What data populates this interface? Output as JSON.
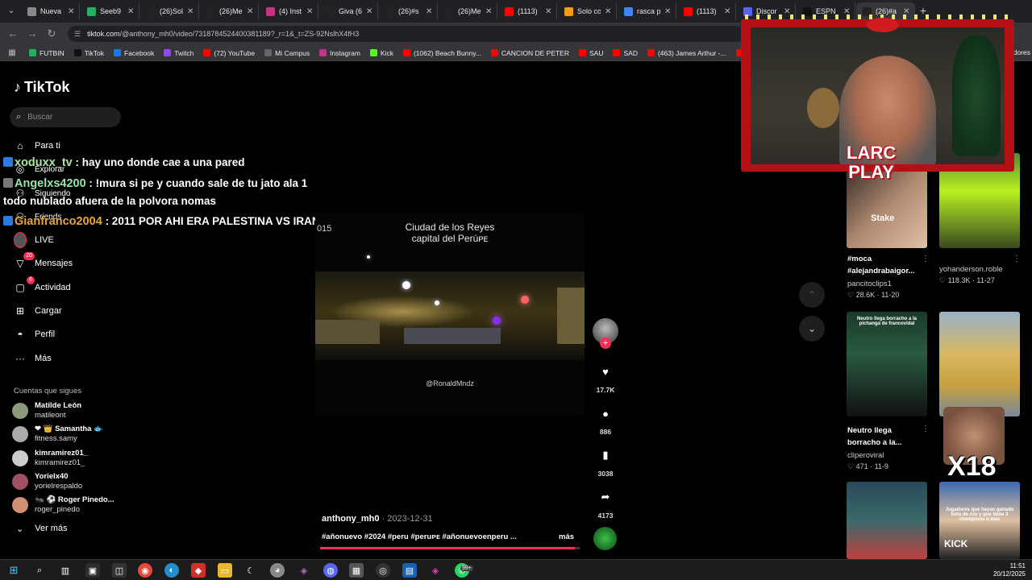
{
  "browser": {
    "tabs": [
      {
        "label": "Nueva",
        "color": "#888888"
      },
      {
        "label": "Seeb9",
        "color": "#27ae60"
      },
      {
        "label": "(26)Sol",
        "color": "#222222"
      },
      {
        "label": "(26)Me",
        "color": "#222222"
      },
      {
        "label": "(4) Inst",
        "color": "#c13584"
      },
      {
        "label": "Giva (6",
        "color": "#222222"
      },
      {
        "label": "(26)#s",
        "color": "#222222"
      },
      {
        "label": "(26)Me",
        "color": "#222222"
      },
      {
        "label": "(1113)",
        "color": "#ff0000"
      },
      {
        "label": "Solo co",
        "color": "#f39c12"
      },
      {
        "label": "rasca p",
        "color": "#4285f4"
      },
      {
        "label": "(1113)",
        "color": "#ff0000"
      },
      {
        "label": "Discor",
        "color": "#5865f2"
      },
      {
        "label": "ESPN",
        "color": "#111111"
      },
      {
        "label": "(26)#a",
        "color": "#222222"
      }
    ],
    "url_host": "tiktok.com",
    "url_path": "/@anthony_mh0/video/7318784524400381189?_r=1&_t=ZS-92NslhX4fH3",
    "bookmarks": [
      {
        "label": "FUTBIN",
        "color": "#27ae60"
      },
      {
        "label": "TikTok",
        "color": "#111111"
      },
      {
        "label": "Facebook",
        "color": "#1877f2"
      },
      {
        "label": "Twitch",
        "color": "#9146ff"
      },
      {
        "label": "(72) YouTube",
        "color": "#ff0000"
      },
      {
        "label": "Mi Campus",
        "color": "#666666"
      },
      {
        "label": "Instagram",
        "color": "#c13584"
      },
      {
        "label": "Kick",
        "color": "#53fc18"
      },
      {
        "label": "(1062) Beach Bunny...",
        "color": "#ff0000"
      },
      {
        "label": "CANCION DE PETER",
        "color": "#ff0000"
      },
      {
        "label": "SAU",
        "color": "#ff0000"
      },
      {
        "label": "SAD",
        "color": "#ff0000"
      },
      {
        "label": "(463) James Arthur -...",
        "color": "#ff0000"
      },
      {
        "label": "DRAGON B",
        "color": "#ff0000"
      }
    ],
    "bookmarks_right": "dores"
  },
  "tiktok": {
    "logo": "TikTok",
    "search_placeholder": "Buscar",
    "nav": [
      {
        "label": "Para ti",
        "icon": "home-icon",
        "glyph": "⌂"
      },
      {
        "label": "Explorar",
        "icon": "compass-icon",
        "glyph": "◎"
      },
      {
        "label": "Siguiendo",
        "icon": "following-icon",
        "glyph": "⚇"
      },
      {
        "label": "Friends",
        "icon": "friends-icon",
        "glyph": "⚇"
      },
      {
        "label": "LIVE",
        "icon": "live-icon",
        "glyph": ""
      },
      {
        "label": "Mensajes",
        "icon": "messages-icon",
        "glyph": "▽",
        "badge": "20"
      },
      {
        "label": "Actividad",
        "icon": "activity-icon",
        "glyph": "▢",
        "badge": "6"
      },
      {
        "label": "Cargar",
        "icon": "upload-icon",
        "glyph": "⊞"
      },
      {
        "label": "Perfil",
        "icon": "profile-icon",
        "glyph": "◓"
      },
      {
        "label": "Más",
        "icon": "more-icon",
        "glyph": "···"
      }
    ],
    "following_title": "Cuentas que sigues",
    "following": [
      {
        "name": "Matilde León",
        "handle": "matileont"
      },
      {
        "name": "❤ 👑 Samantha 🐟",
        "handle": "fitness.samy"
      },
      {
        "name": "kimramirez01_",
        "handle": "kimramirez01_"
      },
      {
        "name": "Yorielx40",
        "handle": "yorielrespaldo"
      },
      {
        "name": "🐜 ⚽ Roger Pinedo...",
        "handle": "roger_pinedo"
      }
    ],
    "see_more": "Ver más"
  },
  "chat": [
    {
      "user": "xoduxx_tv",
      "user_color": "#a8e6a1",
      "text": " : hay uno donde cae a una pared"
    },
    {
      "user": "Angelxs4200",
      "user_color": "#9be3a8",
      "text": " : !mura si pe y cuando sale de tu jato ala 1"
    },
    {
      "user": "",
      "user_color": "#ffffff",
      "text": "todo nublado afuera de la polvora nomas"
    },
    {
      "user": "Gianfranco2004",
      "user_color": "#e8a33d",
      "text": " : 2011 POR AHI ERA PALESTINA VS IRAN"
    }
  ],
  "video": {
    "title_line1": "Ciudad de los Reyes",
    "title_line2": "capital del Perúᴘᴇ",
    "credit": "@RonaldMndz",
    "fragment": "015",
    "author": "anthony_mh0",
    "date": " · 2023-12-31",
    "caption": "#añonuevo #2024 #peru #peruᴘᴇ #añonuevoenperu ...",
    "more": "más",
    "progress": 0.98,
    "likes": "17.7K",
    "comments": "886",
    "saves": "3038",
    "shares": "4173"
  },
  "right": {
    "items": [
      {
        "title": "#moca #alejandrabaigor...",
        "user": "pancitoclips1",
        "meta": "♡ 28.6K · 11-20"
      },
      {
        "title": "",
        "user": "yohanderson.roble",
        "meta": "♡ 118.3K · 11-27"
      },
      {
        "title": "Neutro llega borracho a la...",
        "user": "cliperoviral",
        "meta": "♡ 471 · 11-9"
      },
      {
        "title": "",
        "user": "",
        "meta": ""
      }
    ],
    "thumb_text": "Neutro llega borracho a la pichanga de francovidal",
    "thumb_text2": "Jugadores que hayan ganado bota de oro y que tiene 3 champions o mas",
    "kick": "KICK",
    "stake": "Stake",
    "x18": "X18"
  },
  "stream": {
    "logo_line1": "LARC",
    "logo_line2": "PLAY"
  },
  "taskbar": {
    "time": "11:51",
    "date": "20/12/2025",
    "whatsapp_badge": "99+"
  }
}
